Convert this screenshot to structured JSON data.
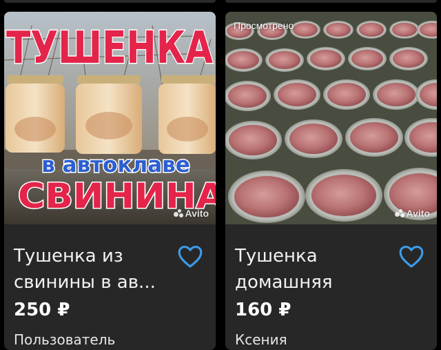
{
  "listings": [
    {
      "title": "Тушенка из свинины в ав...",
      "price": "250 ₽",
      "seller": "Пользователь",
      "image_text": {
        "top": "ТУШЕНКА",
        "middle": "в автоклаве",
        "bottom": "СВИНИНА"
      },
      "watermark": "Avito",
      "favorite_icon": "heart-outline-icon"
    },
    {
      "title": "Тушенка домашняя",
      "price": "160 ₽",
      "seller": "Ксения",
      "badge": "Просмотрено",
      "watermark": "Avito",
      "favorite_icon": "heart-outline-icon"
    }
  ],
  "colors": {
    "background": "#000000",
    "card": "#272727",
    "heart": "#3d9be9",
    "text": "#f2f2f2"
  }
}
